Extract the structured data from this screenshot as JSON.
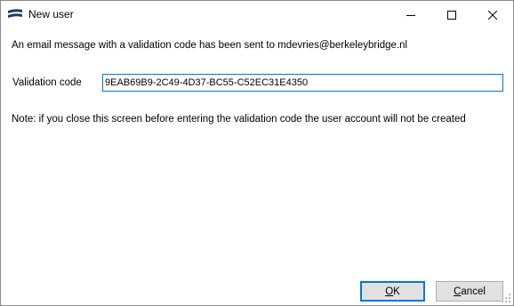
{
  "window": {
    "title": "New user",
    "icon": "app-logo-icon",
    "controls": {
      "minimize": "minimize-icon",
      "maximize": "maximize-icon",
      "close": "close-icon"
    }
  },
  "dialog": {
    "message": "An email message with a validation code has been sent to mdevries@berkeleybridge.nl",
    "validation_label": "Validation code",
    "validation_value": "9EAB69B9-2C49-4D37-BC55-C52EC31E4350",
    "note": "Note: if you close this screen before entering the validation code the user account will not be created"
  },
  "buttons": {
    "ok_mnemonic": "O",
    "ok_rest": "K",
    "cancel_mnemonic": "C",
    "cancel_rest": "ancel"
  },
  "colors": {
    "accent": "#0078d7",
    "button_face": "#e1e1e1",
    "window_bg": "#ffffff"
  }
}
